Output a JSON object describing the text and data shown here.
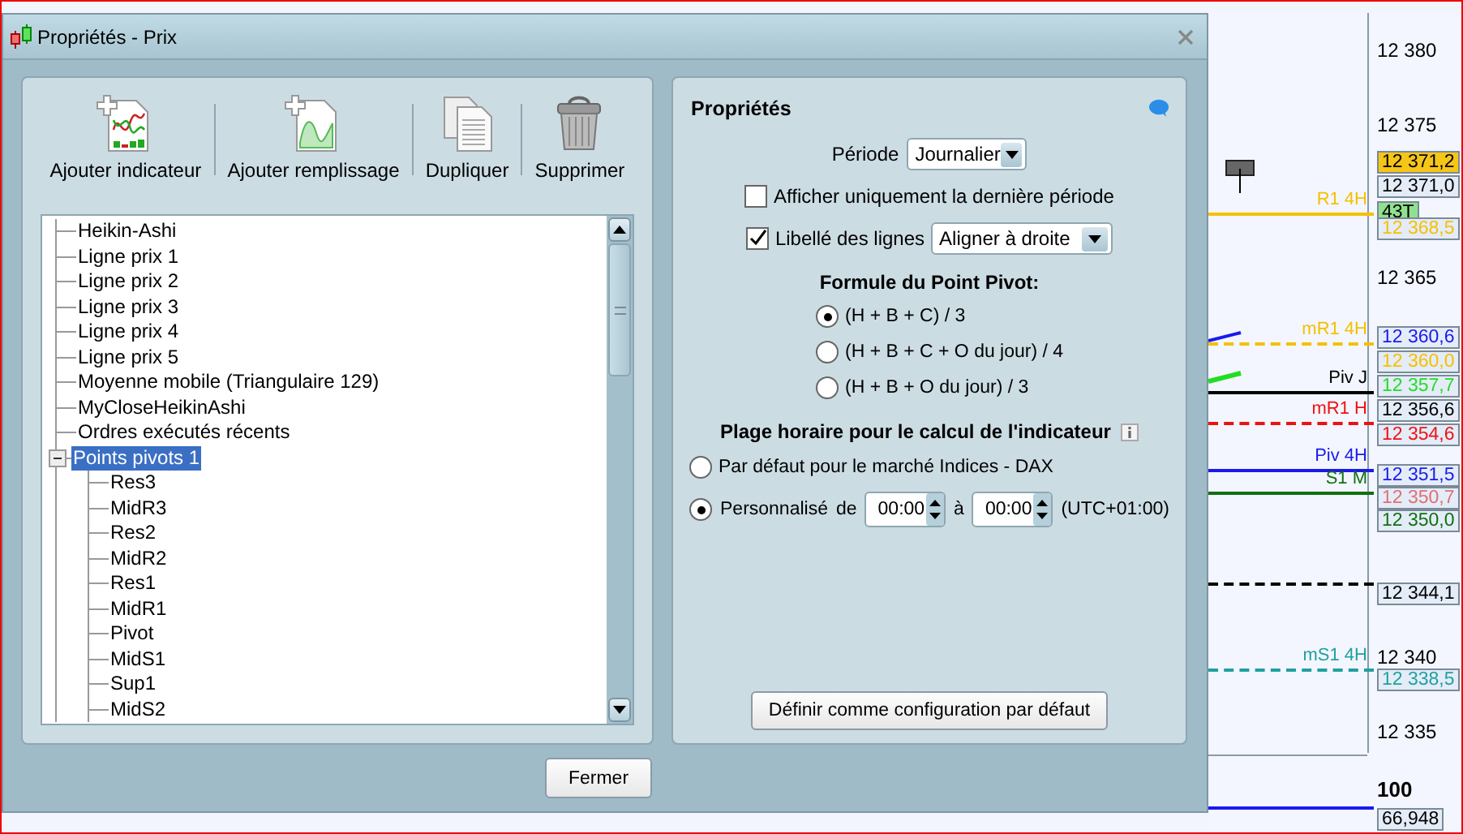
{
  "window": {
    "title": "Propriétés - Prix"
  },
  "toolbar": [
    {
      "label": "Ajouter indicateur",
      "kind": "indicator"
    },
    {
      "label": "Ajouter remplissage",
      "kind": "fill"
    },
    {
      "label": "Dupliquer",
      "kind": "duplicate"
    },
    {
      "label": "Supprimer",
      "kind": "delete"
    }
  ],
  "tree": [
    {
      "label": "Heikin-Ashi",
      "selected": false
    },
    {
      "label": "Ligne prix 1",
      "selected": false
    },
    {
      "label": "Ligne prix 2",
      "selected": false
    },
    {
      "label": "Ligne prix 3",
      "selected": false
    },
    {
      "label": "Ligne prix 4",
      "selected": false
    },
    {
      "label": "Ligne prix 5",
      "selected": false
    },
    {
      "label": "Moyenne mobile (Triangulaire 129)",
      "selected": false
    },
    {
      "label": "MyCloseHeikinAshi",
      "selected": false
    },
    {
      "label": "Ordres exécutés récents",
      "selected": false
    },
    {
      "label": "Points pivots 1",
      "selected": true,
      "expanded": true,
      "children": [
        {
          "label": "Res3",
          "selected": false
        },
        {
          "label": "MidR3",
          "selected": false
        },
        {
          "label": "Res2",
          "selected": false
        },
        {
          "label": "MidR2",
          "selected": false
        },
        {
          "label": "Res1",
          "selected": false
        },
        {
          "label": "MidR1",
          "selected": false
        },
        {
          "label": "Pivot",
          "selected": false
        },
        {
          "label": "MidS1",
          "selected": false
        },
        {
          "label": "Sup1",
          "selected": false
        },
        {
          "label": "MidS2",
          "selected": false
        }
      ]
    }
  ],
  "properties": {
    "title": "Propriétés",
    "period": {
      "label": "Période",
      "value": "Journalier"
    },
    "last_period_only": {
      "label": "Afficher uniquement la dernière période",
      "checked": false
    },
    "line_labels": {
      "label": "Libellé des lignes",
      "checked": true,
      "value": "Aligner à droite"
    },
    "formula": {
      "title": "Formule du Point Pivot:",
      "options": [
        {
          "label": "(H + B + C) / 3",
          "selected": true
        },
        {
          "label": "(H + B + C + O du jour) / 4",
          "selected": false
        },
        {
          "label": "(H + B + O du jour) / 3",
          "selected": false
        }
      ]
    },
    "time_range": {
      "title": "Plage horaire pour le calcul de l'indicateur",
      "default_option": {
        "label": "Par défaut pour le marché Indices - DAX",
        "selected": false
      },
      "custom_option": {
        "label": "Personnalisé",
        "selected": true,
        "from_label": "de",
        "from": "00:00",
        "to_label": "à",
        "to": "00:00",
        "timezone": "(UTC+01:00)"
      }
    },
    "default_button": "Définir comme configuration par défaut"
  },
  "close_button": "Fermer",
  "chart": {
    "ticks": [
      {
        "label": "12 380",
        "kind": "price"
      },
      {
        "label": "12 375",
        "kind": "price"
      },
      {
        "label": "12 365",
        "kind": "price"
      },
      {
        "label": "12 340",
        "kind": "price"
      },
      {
        "label": "12 335",
        "kind": "price"
      },
      {
        "label": "100",
        "kind": "pane_max"
      }
    ],
    "lines": [
      {
        "label": "R1 4H",
        "color": "#f5c000",
        "kind": "solid"
      },
      {
        "label": "mR1 4H",
        "color": "#f5c000",
        "kind": "dashed"
      },
      {
        "label": "Piv J",
        "color": "#000000",
        "kind": "solid"
      },
      {
        "label": "mR1 H",
        "color": "#ee1111",
        "kind": "dashed"
      },
      {
        "label": "Piv 4H",
        "color": "#1a1aee",
        "kind": "solid"
      },
      {
        "label": "S1 M",
        "color": "#107010",
        "kind": "solid"
      },
      {
        "color": "#000000",
        "kind": "dashed"
      },
      {
        "label": "mS1 4H",
        "color": "#20a0a0",
        "kind": "dashed"
      },
      {
        "color": "#1a1aee",
        "kind": "solid"
      }
    ],
    "price_boxes": [
      {
        "text": "12 371,2",
        "kind": "last"
      },
      {
        "text": "12 371,0",
        "color": "#000000",
        "kind": "plain"
      },
      {
        "text": "43T",
        "color": "#000000",
        "kind": "timer"
      },
      {
        "text": "12 368,5",
        "color": "#f5c000",
        "kind": "plain"
      },
      {
        "text": "12 360,6",
        "color": "#1a1aee",
        "kind": "plain"
      },
      {
        "text": "12 360,0",
        "color": "#f5c000",
        "kind": "plain"
      },
      {
        "text": "12 357,7",
        "color": "#22dd22",
        "kind": "plain"
      },
      {
        "text": "12 356,6",
        "color": "#000000",
        "kind": "plain"
      },
      {
        "text": "12 354,6",
        "color": "#ee1111",
        "kind": "plain"
      },
      {
        "text": "12 351,5",
        "color": "#1a1aee",
        "kind": "plain"
      },
      {
        "text": "12 350,7",
        "color": "#e07070",
        "kind": "plain"
      },
      {
        "text": "12 350,0",
        "color": "#107010",
        "kind": "plain"
      },
      {
        "text": "12 344,1",
        "color": "#000000",
        "kind": "plain"
      },
      {
        "text": "12 338,5",
        "color": "#20a0a0",
        "kind": "plain"
      },
      {
        "text": "66,948",
        "color": "#000000",
        "kind": "plain"
      }
    ]
  }
}
